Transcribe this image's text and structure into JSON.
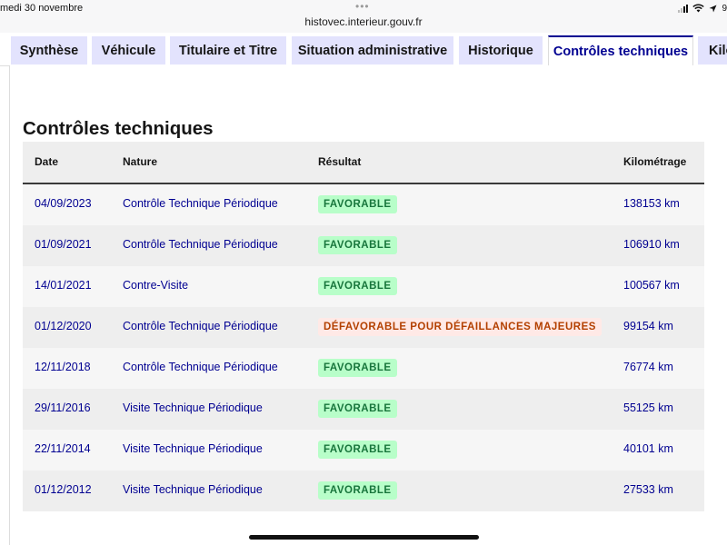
{
  "status": {
    "date": "medi 30 novembre",
    "url": "histovec.interieur.gouv.fr",
    "battery": "9"
  },
  "tabs": [
    {
      "label": "Synthèse",
      "active": false
    },
    {
      "label": "Véhicule",
      "active": false
    },
    {
      "label": "Titulaire et Titre",
      "active": false
    },
    {
      "label": "Situation administrative",
      "active": false
    },
    {
      "label": "Historique",
      "active": false
    },
    {
      "label": "Contrôles techniques",
      "active": true
    },
    {
      "label": "Kilo",
      "active": false
    }
  ],
  "section": {
    "title": "Contrôles techniques"
  },
  "table": {
    "headers": {
      "date": "Date",
      "nature": "Nature",
      "resultat": "Résultat",
      "kilometrage": "Kilométrage"
    },
    "rows": [
      {
        "date": "04/09/2023",
        "nature": "Contrôle Technique Périodique",
        "resultat": "FAVORABLE",
        "status": "ok",
        "km": "138153 km"
      },
      {
        "date": "01/09/2021",
        "nature": "Contrôle Technique Périodique",
        "resultat": "FAVORABLE",
        "status": "ok",
        "km": "106910 km"
      },
      {
        "date": "14/01/2021",
        "nature": "Contre-Visite",
        "resultat": "FAVORABLE",
        "status": "ok",
        "km": "100567 km"
      },
      {
        "date": "01/12/2020",
        "nature": "Contrôle Technique Périodique",
        "resultat": "DÉFAVORABLE POUR DÉFAILLANCES MAJEURES",
        "status": "ko",
        "km": "99154 km"
      },
      {
        "date": "12/11/2018",
        "nature": "Contrôle Technique Périodique",
        "resultat": "FAVORABLE",
        "status": "ok",
        "km": "76774 km"
      },
      {
        "date": "29/11/2016",
        "nature": "Visite Technique Périodique",
        "resultat": "FAVORABLE",
        "status": "ok",
        "km": "55125 km"
      },
      {
        "date": "22/11/2014",
        "nature": "Visite Technique Périodique",
        "resultat": "FAVORABLE",
        "status": "ok",
        "km": "40101 km"
      },
      {
        "date": "01/12/2012",
        "nature": "Visite Technique Périodique",
        "resultat": "FAVORABLE",
        "status": "ok",
        "km": "27533 km"
      }
    ]
  },
  "colors": {
    "accent": "#000091",
    "tab_bg": "#e3e3fd",
    "success_bg": "#b8fec9",
    "success_text": "#18753c",
    "error_bg": "#ffe9e6",
    "error_text": "#b34000"
  }
}
